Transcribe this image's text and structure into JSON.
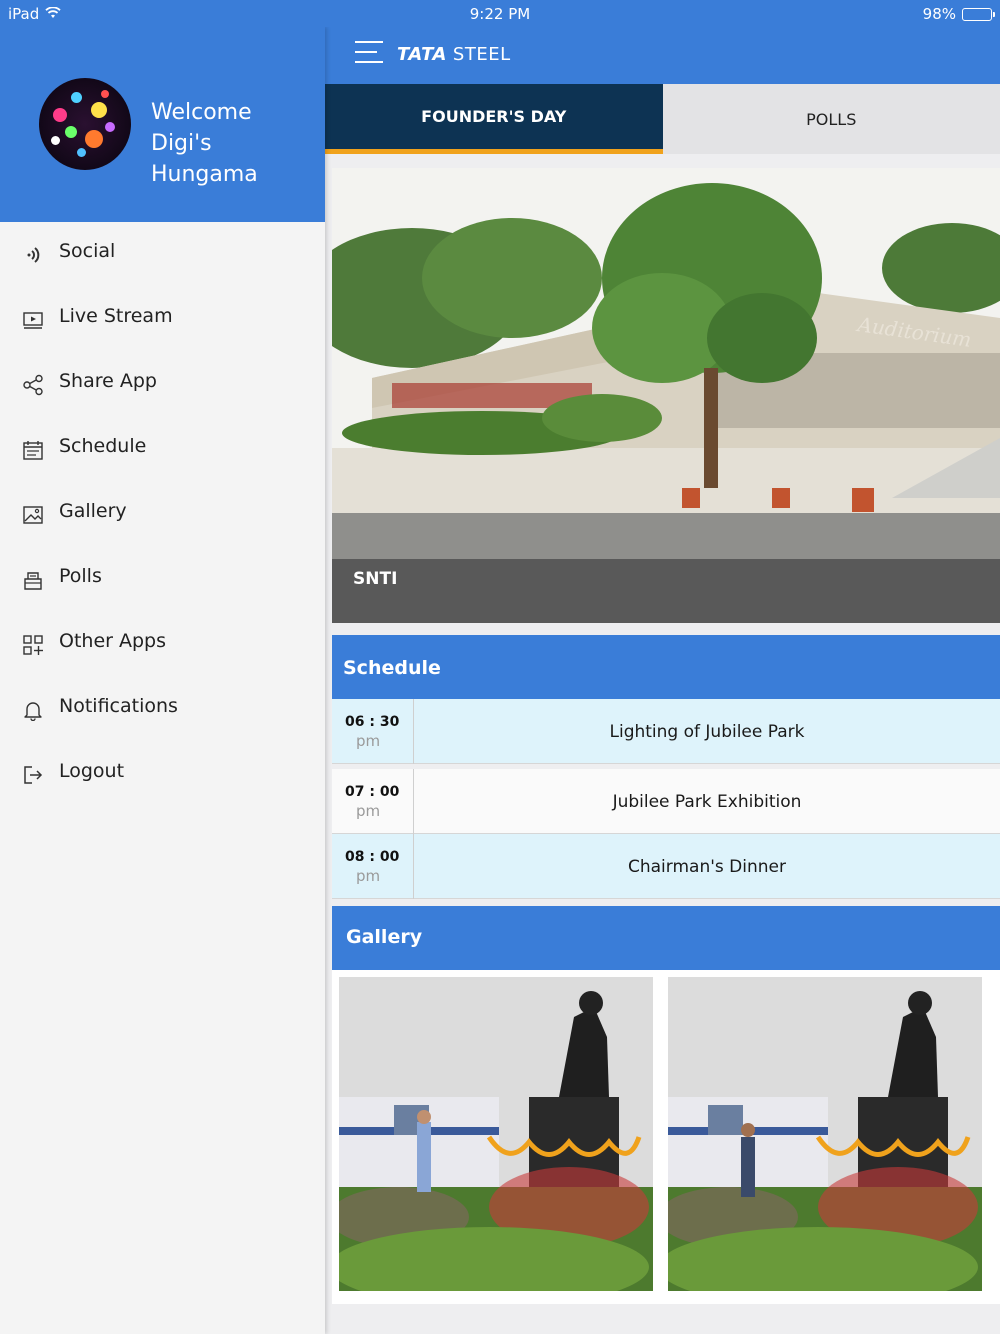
{
  "status_bar": {
    "device": "iPad",
    "time": "9:22 PM",
    "battery": "98%",
    "battery_level": 0.98
  },
  "drawer": {
    "welcome_line1": "Welcome",
    "welcome_line2": "Digi's Hungama",
    "items": [
      {
        "label": "Social",
        "icon": "social-icon"
      },
      {
        "label": "Live Stream",
        "icon": "live-stream-icon"
      },
      {
        "label": "Share App",
        "icon": "share-icon"
      },
      {
        "label": "Schedule",
        "icon": "calendar-icon"
      },
      {
        "label": "Gallery",
        "icon": "gallery-icon"
      },
      {
        "label": "Polls",
        "icon": "polls-icon"
      },
      {
        "label": "Other Apps",
        "icon": "apps-grid-icon"
      },
      {
        "label": "Notifications",
        "icon": "bell-icon"
      },
      {
        "label": "Logout",
        "icon": "logout-icon"
      }
    ]
  },
  "header": {
    "brand_bold": "TATA",
    "brand_rest": "STEEL"
  },
  "tabs": [
    {
      "label": "FOUNDER'S DAY",
      "active": true
    },
    {
      "label": "POLLS",
      "active": false
    }
  ],
  "hero": {
    "caption": "SNTI",
    "building_sign": "Auditorium"
  },
  "schedule": {
    "title": "Schedule",
    "rows": [
      {
        "time": "06 : 30",
        "ampm": "pm",
        "event": "Lighting of Jubilee Park"
      },
      {
        "time": "07 : 00",
        "ampm": "pm",
        "event": "Jubilee Park Exhibition"
      },
      {
        "time": "08 : 00",
        "ampm": "pm",
        "event": "Chairman's Dinner"
      }
    ]
  },
  "gallery": {
    "title": "Gallery"
  },
  "colors": {
    "primary": "#3a7dd8",
    "tab_active": "#0d3353",
    "tab_accent": "#f0a21c",
    "row_highlight": "#def3fb"
  }
}
